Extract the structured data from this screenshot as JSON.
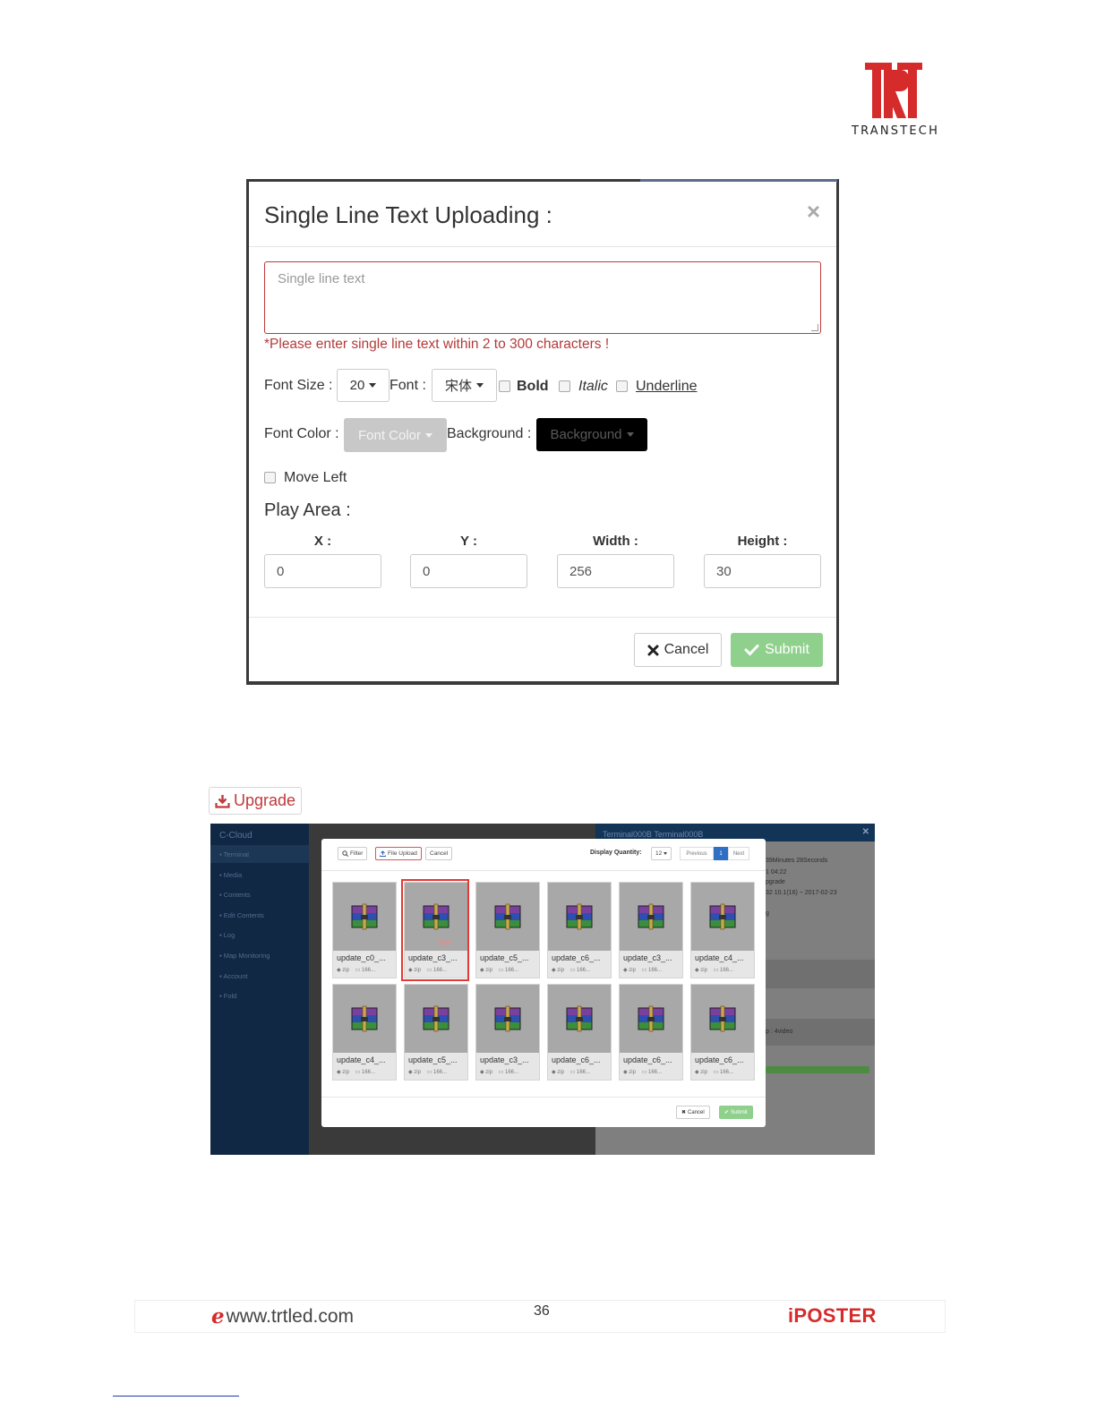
{
  "brand": {
    "logo_text": "TRANSTECH"
  },
  "modal": {
    "title": "Single Line Text Uploading :",
    "close_glyph": "×",
    "text_placeholder": "Single line text",
    "error": "*Please enter single line text within 2 to 300 characters !",
    "font_size_label": "Font Size :",
    "font_size_value": "20",
    "font_label": "Font :",
    "font_value": "宋体",
    "bold_label": "Bold",
    "italic_label": "Italic",
    "underline_label": "Underline",
    "font_color_label": "Font Color :",
    "font_color_button": "Font Color",
    "background_label": "Background :",
    "background_button": "Background",
    "move_left_label": "Move Left",
    "play_area_title": "Play Area :",
    "x_label": "X :",
    "x_value": "0",
    "y_label": "Y :",
    "y_value": "0",
    "width_label": "Width :",
    "width_value": "256",
    "height_label": "Height :",
    "height_value": "30",
    "cancel_label": "Cancel",
    "submit_label": "Submit",
    "colors": {
      "error": "#b33a3a",
      "submit": "#8fd08d",
      "font_color_btn": "#c8c8c8",
      "background_btn": "#000000"
    }
  },
  "upgrade_button": {
    "label": "Upgrade"
  },
  "shot2": {
    "sidebar": {
      "logo": "C-Cloud",
      "items": [
        "Terminal",
        "Media",
        "Contents",
        "Edit Contents",
        "Log",
        "Map Monitoring",
        "Account",
        "Fold"
      ]
    },
    "topbar_title": "Terminal000B  Terminal000B",
    "right_lines": [
      "39Minutes 28Seconds",
      "1 04:22",
      "pgrade",
      "32 10.1(16) ~ 2017-02-23",
      "g",
      "p : 4video"
    ],
    "toolbar": {
      "filter": "Filter",
      "file_upload": "File Upload",
      "cancel": "Cancel"
    },
    "display_quantity_label": "Display Quantity:",
    "display_quantity_value": "12",
    "pager": {
      "previous": "Previous",
      "current": "1",
      "next": "Next"
    },
    "selected_type_label": "type",
    "files": [
      {
        "name": "update_c0_...",
        "ext": "zip",
        "size": "166..."
      },
      {
        "name": "update_c3_...",
        "ext": "zip",
        "size": "166..."
      },
      {
        "name": "update_c5_...",
        "ext": "zip",
        "size": "166..."
      },
      {
        "name": "update_c6_...",
        "ext": "zip",
        "size": "166..."
      },
      {
        "name": "update_c3_...",
        "ext": "zip",
        "size": "166..."
      },
      {
        "name": "update_c4_...",
        "ext": "zip",
        "size": "166..."
      },
      {
        "name": "update_c4_...",
        "ext": "zip",
        "size": "166..."
      },
      {
        "name": "update_c5_...",
        "ext": "zip",
        "size": "166..."
      },
      {
        "name": "update_c3_...",
        "ext": "zip",
        "size": "166..."
      },
      {
        "name": "update_c6_...",
        "ext": "zip",
        "size": "166..."
      },
      {
        "name": "update_c6_...",
        "ext": "zip",
        "size": "166..."
      },
      {
        "name": "update_c6_...",
        "ext": "zip",
        "size": "166..."
      }
    ],
    "selected_index": 1,
    "footer": {
      "cancel": "Cancel",
      "submit": "Submit"
    }
  },
  "footer": {
    "website": "www.trtled.com",
    "page_number": "36",
    "brand": "iPOSTER"
  }
}
